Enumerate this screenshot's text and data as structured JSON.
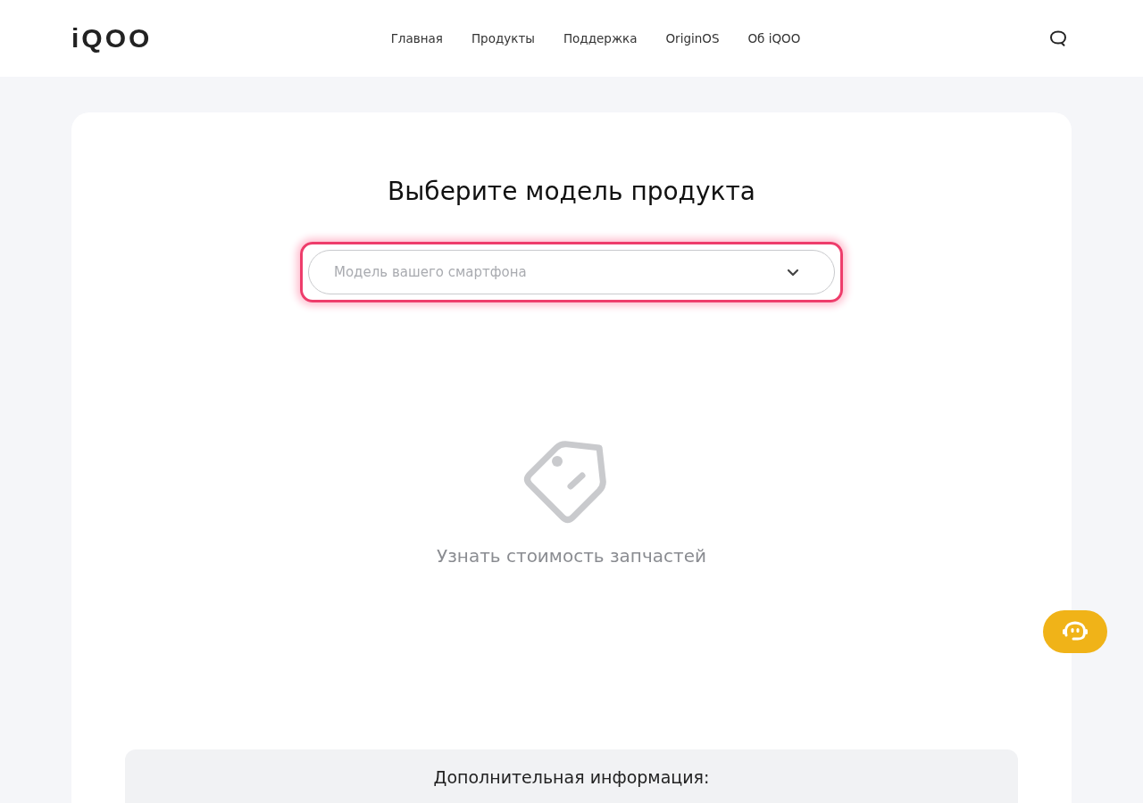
{
  "header": {
    "logo": "iQOO",
    "nav": [
      {
        "label": "Главная"
      },
      {
        "label": "Продукты"
      },
      {
        "label": "Поддержка"
      },
      {
        "label": "OriginOS"
      },
      {
        "label": "Об iQOO"
      }
    ]
  },
  "main": {
    "title": "Выберите модель продукта",
    "model_select": {
      "placeholder": "Модель вашего смартфона",
      "highlighted": true
    },
    "empty_state": {
      "text": "Узнать стоимость запчастей"
    },
    "info_panel": {
      "title": "Дополнительная информация:"
    }
  }
}
